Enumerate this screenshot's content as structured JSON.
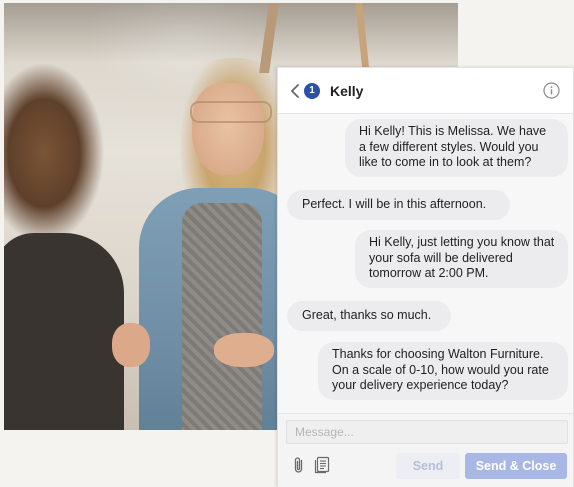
{
  "chat": {
    "unread_count": "1",
    "contact_name": "Kelly",
    "messages": [
      {
        "direction": "out",
        "text": "Hi Kelly! This is Melissa. We have a few different styles. Would you like to come in to look at them?"
      },
      {
        "direction": "in",
        "text": "Perfect. I will be in this afternoon."
      },
      {
        "direction": "out",
        "text": "Hi Kelly, just letting you know that your sofa will be delivered tomorrow at 2:00 PM."
      },
      {
        "direction": "in",
        "text": "Great, thanks so much."
      },
      {
        "direction": "out",
        "text": "Thanks for choosing Walton Furniture. On a scale of 0-10, how would you rate your delivery experience today?"
      }
    ]
  },
  "composer": {
    "placeholder": "Message...",
    "value": "",
    "send_label": "Send",
    "send_close_label": "Send & Close"
  },
  "icons": {
    "back": "chevron-left-icon",
    "info": "info-icon",
    "attach": "paperclip-icon",
    "template": "template-icon"
  },
  "colors": {
    "badge": "#2c4fa8",
    "bubble": "#ececee",
    "send_close_button": "#a9b7e4",
    "send_button_text": "#b7c0d8"
  }
}
